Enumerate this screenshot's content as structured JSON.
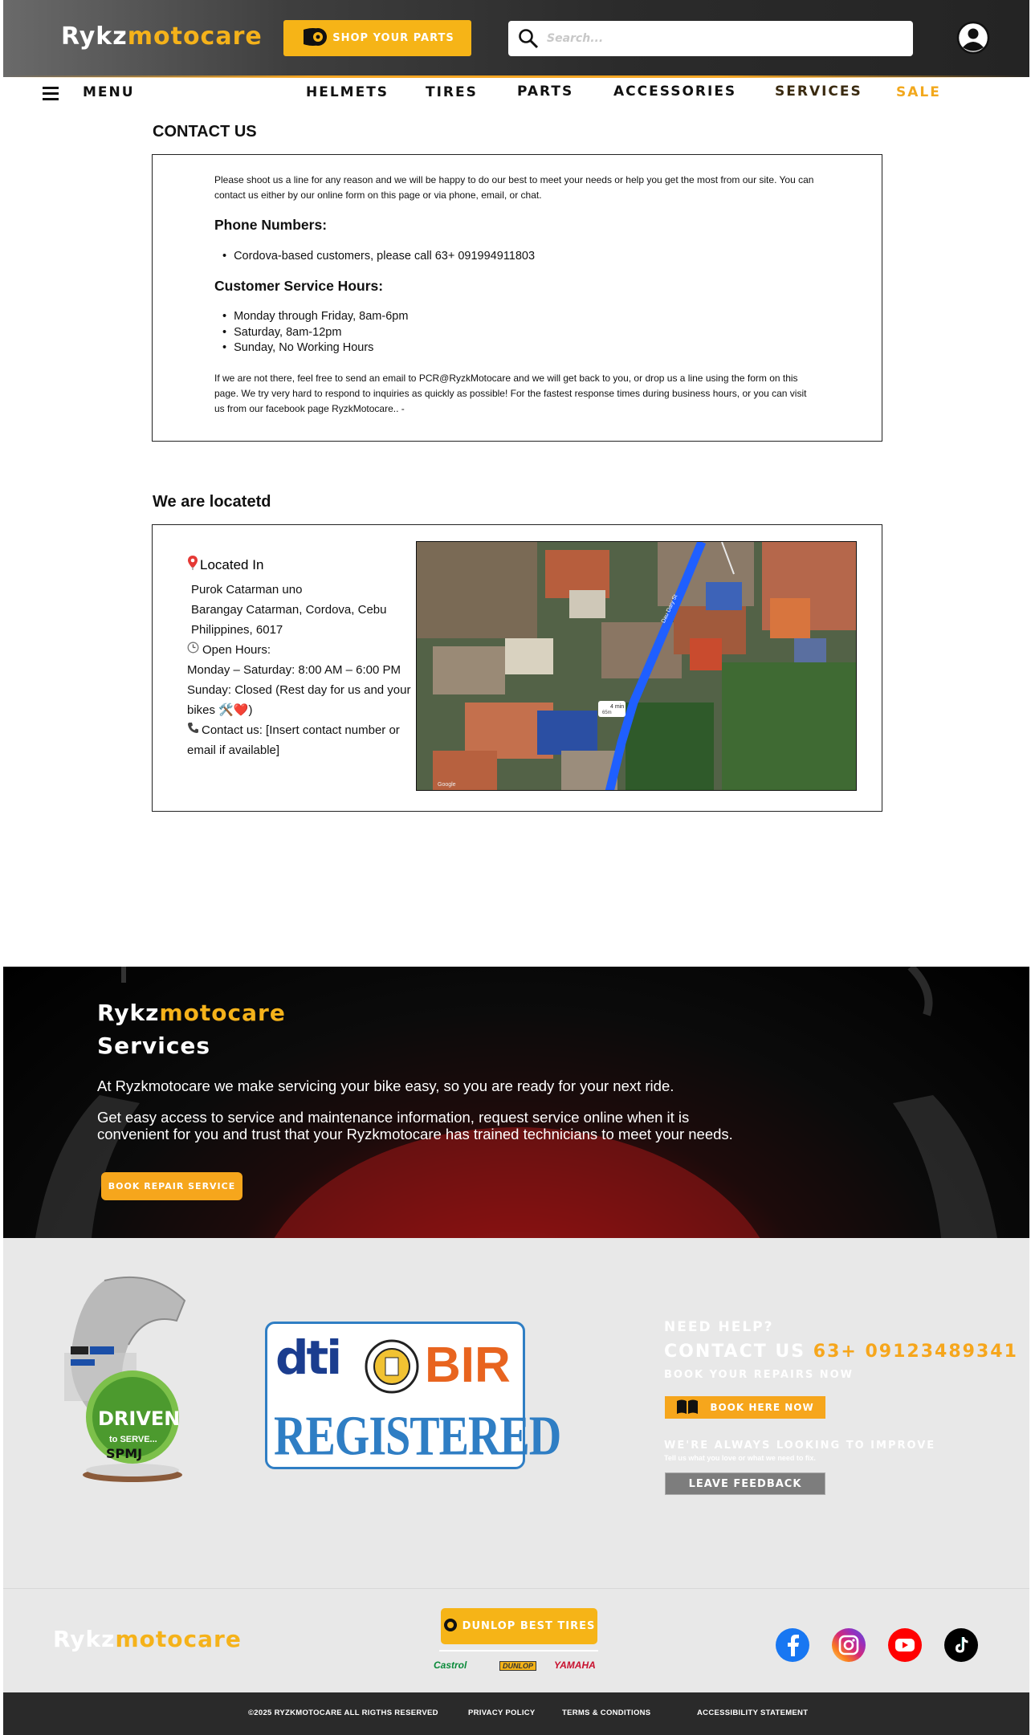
{
  "header": {
    "logo_part1": "Rykz",
    "logo_part2": "motocare",
    "shop_button": "SHOP YOUR PARTS",
    "search_placeholder": "Search...",
    "colors": {
      "accent": "#f6b417",
      "header_bg": "#2b2b2b"
    }
  },
  "nav": {
    "menu_label": "MENU",
    "items": [
      "HELMETS",
      "TIRES",
      "PARTS",
      "ACCESSORIES",
      "SERVICES",
      "SALE"
    ]
  },
  "contact": {
    "heading": "CONTACT US",
    "intro": "Please shoot us a line for any reason and we will be happy to do our best to meet your needs or help you get the most from our site. You can contact us either by our online form on this page or via phone, email, or chat.",
    "phone_heading": "Phone Numbers:",
    "phone_items": [
      "Cordova-based customers, please call 63+ 091994911803"
    ],
    "hours_heading": "Customer Service Hours:",
    "hours_items": [
      "Monday through Friday, 8am-6pm",
      "Saturday, 8am-12pm",
      "Sunday, No Working Hours"
    ],
    "outro": "If we are not there, feel free to send an email to PCR@RyzkMotocare and we will get back to you, or drop us a line using the form on this page. We try very hard to respond to inquiries as quickly as possible! For the fastest response times during business hours, or you can visit us from our facebook page RyzkMotocare.. -"
  },
  "location": {
    "heading": "We are locatetd",
    "located_in_label": "Located In",
    "address_lines": [
      "Purok Catarman uno",
      "Barangay Catarman, Cordova, Cebu",
      "Philippines, 6017"
    ],
    "open_hours_label": "Open Hours:",
    "weekday_hours": "Monday – Saturday: 8:00 AM – 6:00 PM",
    "sunday_hours_1": "Sunday: Closed (Rest day for us and your",
    "sunday_hours_2": "bikes 🛠️❤️)",
    "contact_1": "Contact us: [Insert contact number or",
    "contact_2": "email if available]",
    "map": {
      "route_badge": "4 min",
      "route_distance": "65m",
      "street": "Dau Dary St",
      "google_mark": "Google"
    }
  },
  "services": {
    "title_part1": "Rykz",
    "title_part2": "motocare",
    "title_line2": "Services",
    "para1": "At Ryzkmotocare we make servicing your bike easy, so you are ready for your next ride.",
    "para2_line1": "Get easy access to service and maintenance information, request service online when it is",
    "para2_line2": "convenient for you and trust that your Ryzkmotocare has trained technicians to meet your needs.",
    "button": "BOOK REPAIR SERVICE"
  },
  "badges": {
    "award_word": "DRIVEN",
    "award_sub": "to SERVE...",
    "award_org": "SPMJ",
    "dti": "dti",
    "bir": "BIR",
    "registered": "REGISTERED"
  },
  "help": {
    "need_help": "NEED HELP?",
    "contact_label": "CONTACT US",
    "contact_number": "63+ 09123489341",
    "book_repairs": "BOOK YOUR REPAIRS NOW",
    "book_button": "BOOK HERE NOW",
    "improve": "WE'RE ALWAYS LOOKING TO IMPROVE",
    "improve_sub": "Tell us what you love or what we need to fix.",
    "feedback_button": "LEAVE FEEDBACK"
  },
  "footer": {
    "logo_part1": "Rykz",
    "logo_part2": "motocare",
    "dunlop_button": "DUNLOP BEST TIRES",
    "brands": [
      "Castrol",
      "DUNLOP",
      "YAMAHA"
    ],
    "social": [
      "facebook",
      "instagram",
      "youtube",
      "tiktok"
    ],
    "legal": {
      "copyright": "©2025 RYZKMOTOCARE ALL RIGTHS RESERVED",
      "privacy": "PRIVACY POLICY",
      "terms": "TERMS & CONDITIONS",
      "accessibility": "ACCESSIBILITY STATEMENT"
    }
  }
}
